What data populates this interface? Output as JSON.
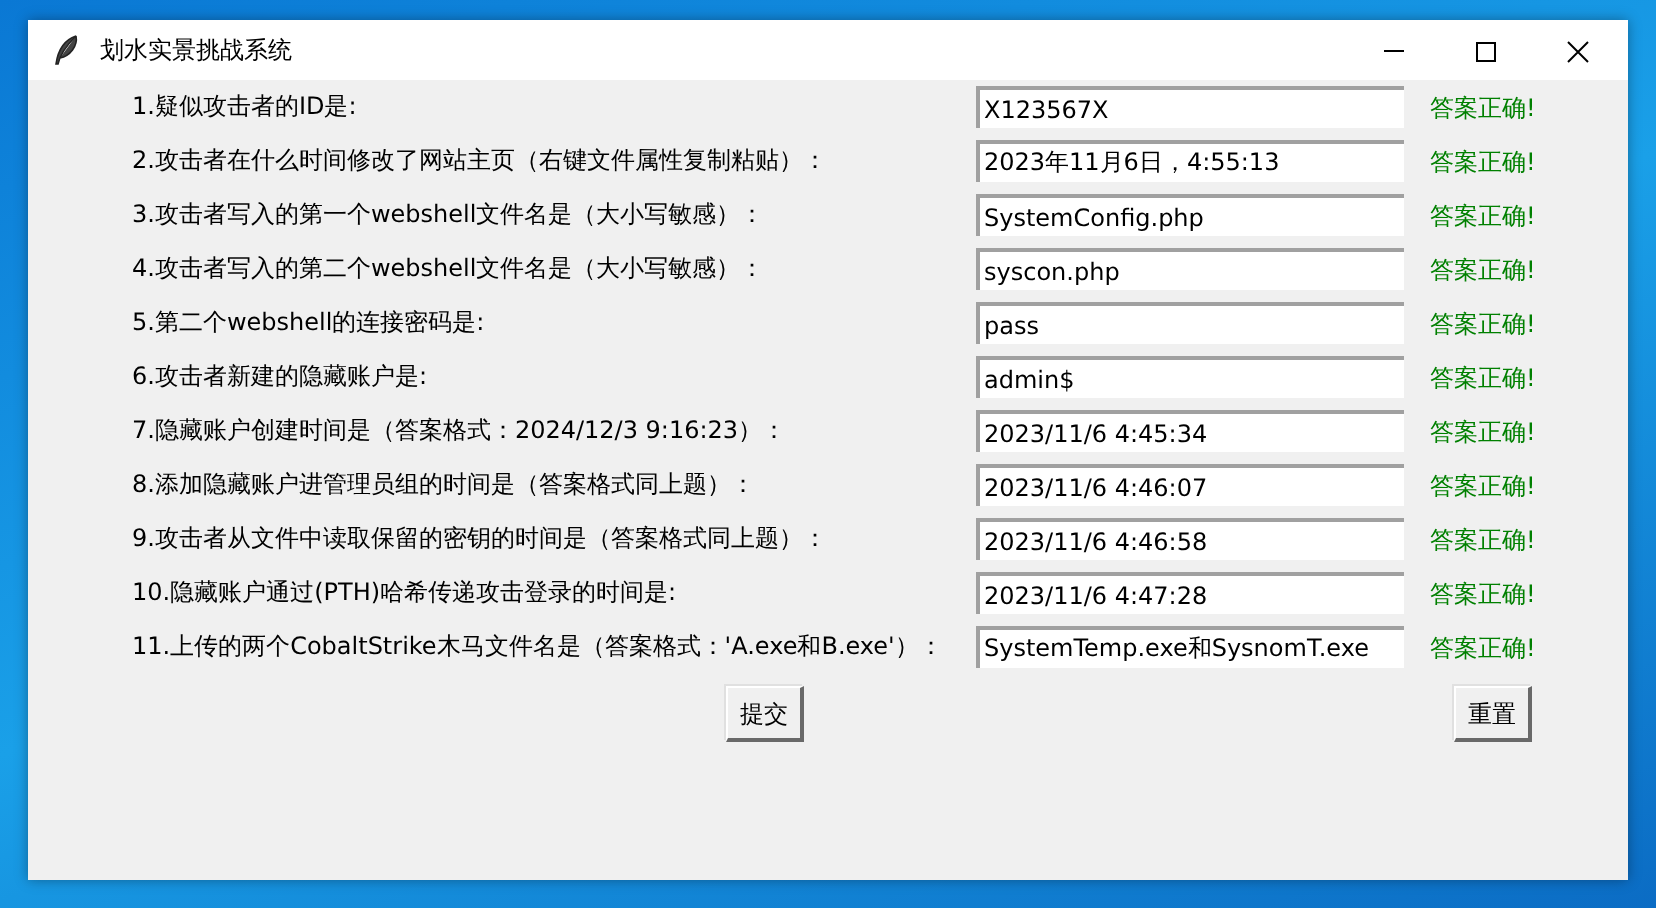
{
  "window": {
    "title": "划水实景挑战系统"
  },
  "questions": [
    {
      "label": "1.疑似攻击者的ID是:",
      "value": "X123567X",
      "result": "答案正确!",
      "correct": true
    },
    {
      "label": "2.攻击者在什么时间修改了网站主页（右键文件属性复制粘贴）：",
      "value": "2023年11月6日，4:55:13",
      "result": "答案正确!",
      "correct": true
    },
    {
      "label": "3.攻击者写入的第一个webshell文件名是（大小写敏感）：",
      "value": "SystemConfig.php",
      "result": "答案正确!",
      "correct": true
    },
    {
      "label": "4.攻击者写入的第二个webshell文件名是（大小写敏感）：",
      "value": "syscon.php",
      "result": "答案正确!",
      "correct": true
    },
    {
      "label": "5.第二个webshell的连接密码是:",
      "value": "pass",
      "result": "答案正确!",
      "correct": true
    },
    {
      "label": "6.攻击者新建的隐藏账户是:",
      "value": "admin$",
      "result": "答案正确!",
      "correct": true
    },
    {
      "label": "7.隐藏账户创建时间是（答案格式：2024/12/3 9:16:23）：",
      "value": "2023/11/6 4:45:34",
      "result": "答案正确!",
      "correct": true
    },
    {
      "label": "8.添加隐藏账户进管理员组的时间是（答案格式同上题）：",
      "value": "2023/11/6 4:46:07",
      "result": "答案正确!",
      "correct": true
    },
    {
      "label": "9.攻击者从文件中读取保留的密钥的时间是（答案格式同上题）：",
      "value": "2023/11/6 4:46:58",
      "result": "答案正确!",
      "correct": true
    },
    {
      "label": "10.隐藏账户通过(PTH)哈希传递攻击登录的时间是:",
      "value": "2023/11/6 4:47:28",
      "result": "答案正确!",
      "correct": true
    },
    {
      "label": "11.上传的两个CobaltStrike木马文件名是（答案格式：'A.exe和B.exe'）：",
      "value": "SystemTemp.exe和SysnomT.exe",
      "result": "答案正确!",
      "correct": true
    }
  ],
  "buttons": {
    "submit": "提交",
    "reset": "重置"
  }
}
